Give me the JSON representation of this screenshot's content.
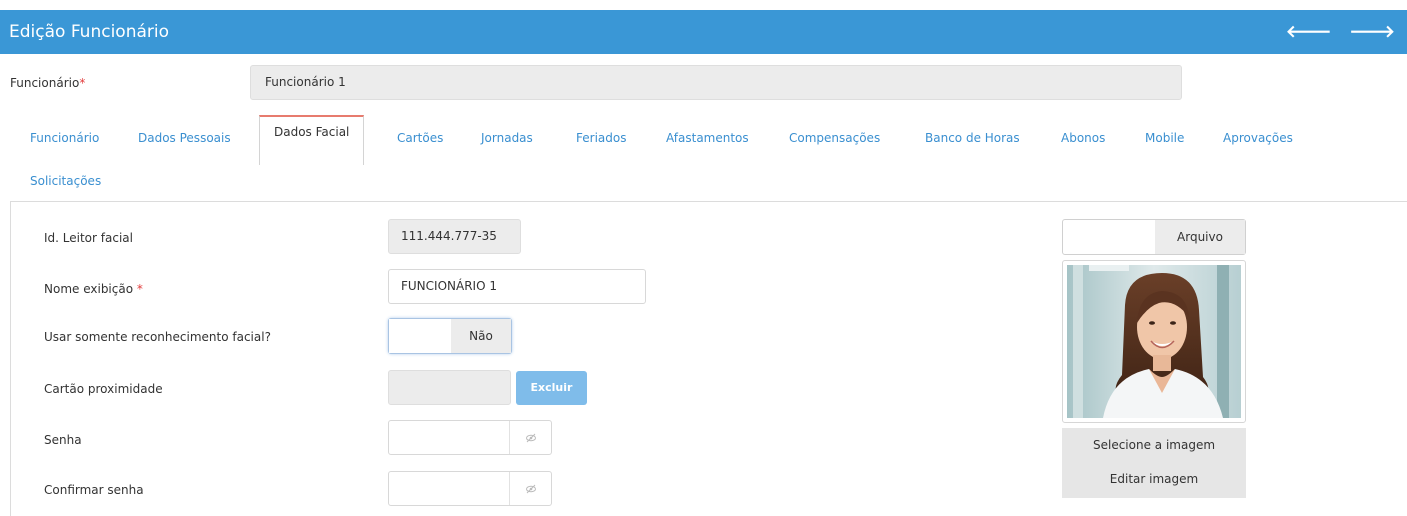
{
  "header": {
    "title": "Edição Funcionário",
    "prev_icon": "arrow-left-icon",
    "next_icon": "arrow-right-icon",
    "prev_symbol": "🡐",
    "next_symbol": "🡒"
  },
  "employee": {
    "label": "Funcionário",
    "required_mark": "*",
    "value": "Funcionário 1"
  },
  "tabs": [
    {
      "label": "Funcionário"
    },
    {
      "label": "Dados Pessoais"
    },
    {
      "label": "Dados Facial",
      "active": true
    },
    {
      "label": "Cartões"
    },
    {
      "label": "Jornadas"
    },
    {
      "label": "Feriados"
    },
    {
      "label": "Afastamentos"
    },
    {
      "label": "Compensações"
    },
    {
      "label": "Banco de Horas"
    },
    {
      "label": "Abonos"
    },
    {
      "label": "Mobile"
    },
    {
      "label": "Aprovações"
    },
    {
      "label": "Solicitações"
    }
  ],
  "form": {
    "facial_id": {
      "label": "Id. Leitor facial",
      "value": "111.444.777-35"
    },
    "display_name": {
      "label": "Nome exibição",
      "required_mark": "*",
      "value": "FUNCIONÁRIO 1"
    },
    "facial_only": {
      "label": "Usar somente reconhecimento facial?",
      "value": "Não"
    },
    "proximity_card": {
      "label": "Cartão proximidade",
      "value": "",
      "delete_label": "Excluir"
    },
    "password": {
      "label": "Senha",
      "value": ""
    },
    "confirm_password": {
      "label": "Confirmar senha",
      "value": ""
    }
  },
  "photo": {
    "file_button": "Arquivo",
    "select_button": "Selecione a imagem",
    "edit_button": "Editar imagem"
  },
  "colors": {
    "header_bg": "#3a97d6",
    "tab_link": "#3a8fd0",
    "active_tab_accent": "#e77b6e",
    "required": "#e23c3c",
    "delete_button": "#7fbcea"
  }
}
